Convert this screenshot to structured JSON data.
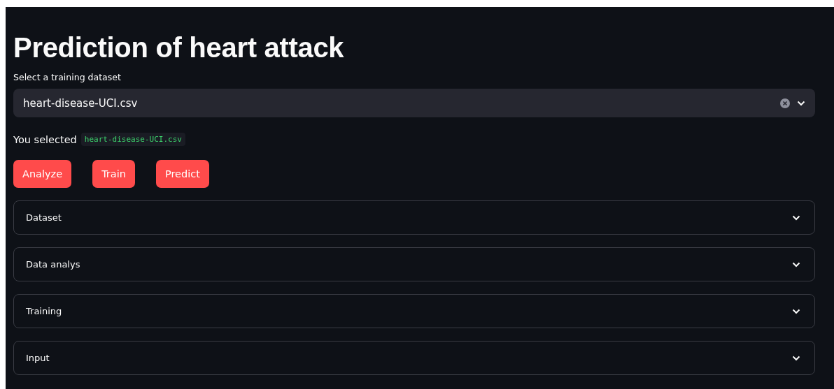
{
  "title": "Prediction of heart attack",
  "dataset_select": {
    "label": "Select a training dataset",
    "value": "heart-disease-UCI.csv"
  },
  "selection_note": {
    "text": "You selected",
    "code": "heart-disease-UCI.csv"
  },
  "buttons": [
    "Analyze",
    "Train",
    "Predict"
  ],
  "expanders": [
    {
      "label": "Dataset",
      "expanded": false
    },
    {
      "label": "Data analys",
      "expanded": false
    },
    {
      "label": "Training",
      "expanded": false
    },
    {
      "label": "Input",
      "expanded": false
    }
  ]
}
